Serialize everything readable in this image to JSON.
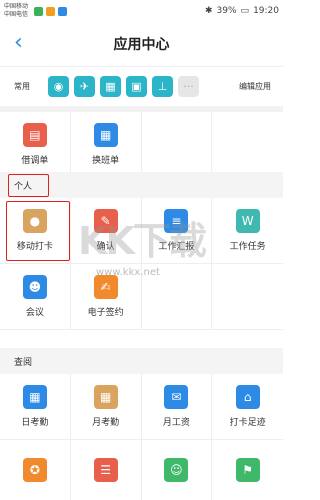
{
  "status": {
    "carrier1": "中国移动",
    "carrier2": "中国电信",
    "battery": "39%",
    "time": "19:20"
  },
  "header": {
    "back_icon": "chevron-left-icon",
    "title": "应用中心"
  },
  "common": {
    "label": "常用",
    "edit_label": "编辑应用",
    "icons": [
      "chat-icon",
      "plane-icon",
      "calendar-icon",
      "clipboard-icon",
      "stamp-icon",
      "more-icon"
    ]
  },
  "top_apps": [
    {
      "label": "借调单",
      "color": "#e8604c",
      "icon": "card-icon"
    },
    {
      "label": "换班单",
      "color": "#2d8be6",
      "icon": "calendar-icon"
    }
  ],
  "sections": {
    "personal": "个人",
    "query": "查阅"
  },
  "personal_apps": [
    {
      "label": "移动打卡",
      "color": "#d9a45e",
      "icon": "location-pin-icon"
    },
    {
      "label": "确认",
      "color": "#e8604c",
      "icon": "pen-icon"
    },
    {
      "label": "工作汇报",
      "color": "#2d8be6",
      "icon": "report-icon"
    },
    {
      "label": "工作任务",
      "color": "#3fb8b0",
      "icon": "task-icon"
    },
    {
      "label": "会议",
      "color": "#2d8be6",
      "icon": "person-icon"
    },
    {
      "label": "电子签约",
      "color": "#f08a2c",
      "icon": "contract-icon"
    }
  ],
  "query_apps": [
    {
      "label": "日考勤",
      "color": "#2d8be6",
      "icon": "calendar-icon"
    },
    {
      "label": "月考勤",
      "color": "#d9a45e",
      "icon": "calendar-icon"
    },
    {
      "label": "月工资",
      "color": "#2d8be6",
      "icon": "envelope-icon"
    },
    {
      "label": "打卡足迹",
      "color": "#2d8be6",
      "icon": "footprint-icon"
    },
    {
      "label": "",
      "color": "#f08a2c",
      "icon": "medal-icon"
    },
    {
      "label": "",
      "color": "#e8604c",
      "icon": "list-icon"
    },
    {
      "label": "",
      "color": "#3fb86a",
      "icon": "contact-icon"
    },
    {
      "label": "",
      "color": "#3fb86a",
      "icon": "flag-icon"
    }
  ],
  "watermark": {
    "big": "KK下载",
    "small": "www.kkx.net"
  }
}
